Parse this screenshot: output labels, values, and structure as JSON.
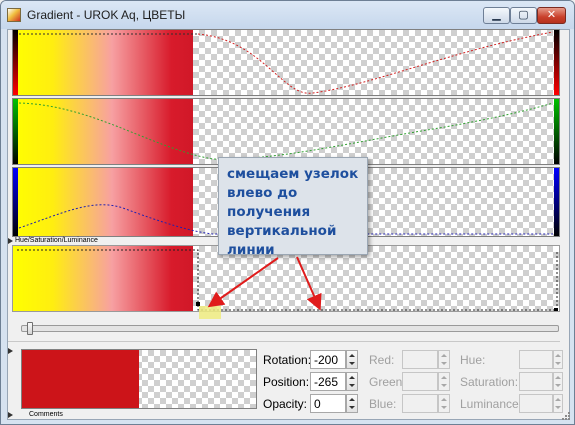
{
  "window": {
    "title": "Gradient - UROK Aq, ЦВЕТЫ",
    "controls": {
      "minimize": "▁",
      "maximize": "▢",
      "close": "✕"
    }
  },
  "channels": [
    {
      "name": "red",
      "strip_color": "#ff0000",
      "icon": "red-channel-strip"
    },
    {
      "name": "green",
      "strip_color": "#00c000",
      "icon": "green-channel-strip"
    },
    {
      "name": "blue",
      "strip_color": "#0000ff",
      "icon": "blue-channel-strip"
    }
  ],
  "section_labels": {
    "hsl": "Hue/Saturation/Luminance",
    "comments": "Comments"
  },
  "gradient": {
    "colors": [
      "#ffff00",
      "#ffee10",
      "#f7a0a2",
      "#d81b2b"
    ]
  },
  "annotation": {
    "text": "смещаем узелок\nвлево до\nполучения\nвертикальной\nлинии",
    "text_color": "#1e4f9e",
    "arrow_color": "#e01b1b"
  },
  "slider": {
    "value": 0
  },
  "preview": {
    "color": "#cc1419"
  },
  "transform": {
    "rotation_label": "Rotation:",
    "rotation_value": "-200",
    "position_label": "Position:",
    "position_value": "-265",
    "opacity_label": "Opacity:",
    "opacity_value": "0"
  },
  "rgb": {
    "red_label": "Red:",
    "green_label": "Green:",
    "blue_label": "Blue:"
  },
  "hsl": {
    "hue_label": "Hue:",
    "saturation_label": "Saturation:",
    "luminance_label": "Luminance:"
  }
}
